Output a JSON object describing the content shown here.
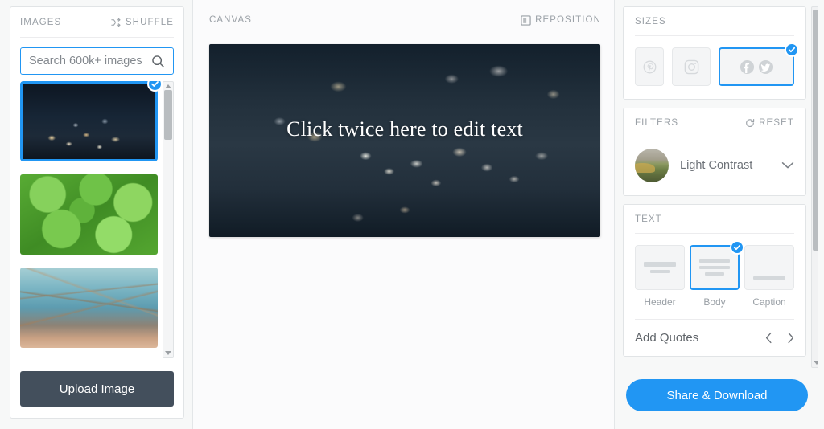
{
  "left_panel": {
    "title": "IMAGES",
    "shuffle_label": "SHUFFLE",
    "shuffle_icon": "shuffle-icon",
    "search": {
      "value": "",
      "placeholder": "Search 600k+ images",
      "icon": "search-icon"
    },
    "thumbnails": [
      {
        "name": "night-city-street",
        "selected": true
      },
      {
        "name": "green-clover-leaves",
        "selected": false
      },
      {
        "name": "grass-against-sky",
        "selected": false
      }
    ],
    "upload_label": "Upload Image"
  },
  "canvas_panel": {
    "title": "CANVAS",
    "reposition_label": "REPOSITION",
    "reposition_icon": "reposition-icon",
    "overlay_text": "Click twice here to edit text"
  },
  "right_panel": {
    "sizes": {
      "title": "SIZES",
      "options": [
        {
          "name": "pinterest",
          "icon": "pinterest-icon",
          "selected": false
        },
        {
          "name": "instagram",
          "icon": "instagram-icon",
          "selected": false
        },
        {
          "name": "facebook-twitter",
          "icon": "facebook-twitter-icon",
          "selected": true
        }
      ]
    },
    "filters": {
      "title": "FILTERS",
      "reset_label": "RESET",
      "reset_icon": "reset-icon",
      "selected_filter": "Light Contrast",
      "chevron_icon": "chevron-down-icon"
    },
    "text": {
      "title": "TEXT",
      "options": [
        {
          "label": "Header",
          "selected": false
        },
        {
          "label": "Body",
          "selected": true
        },
        {
          "label": "Caption",
          "selected": false
        }
      ],
      "quotes_label": "Add Quotes",
      "prev_icon": "chevron-left-icon",
      "next_icon": "chevron-right-icon"
    },
    "share_label": "Share & Download"
  },
  "colors": {
    "accent": "#2196f3",
    "upload_button": "#434f5c",
    "muted_text": "#9aa0a6"
  }
}
